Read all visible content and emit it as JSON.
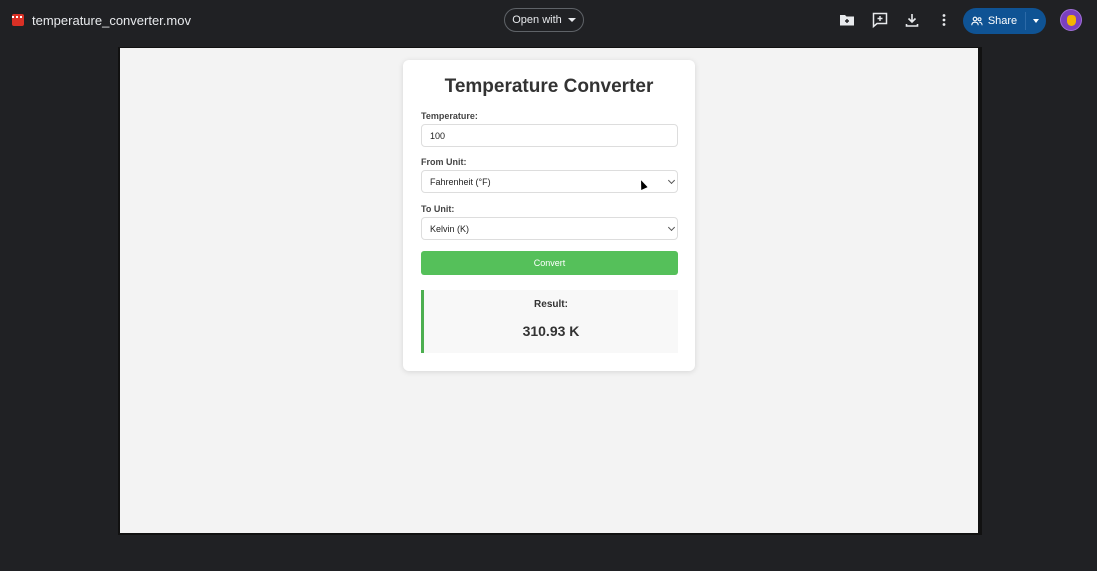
{
  "topbar": {
    "file_icon": "video-file-icon",
    "file_name": "temperature_converter.mov",
    "open_with_label": "Open with",
    "icons": [
      "add-to-drive-icon",
      "add-comment-icon",
      "download-icon",
      "more-vert-icon"
    ],
    "share_label": "Share",
    "accent_color": "#0f5394"
  },
  "converter": {
    "title": "Temperature Converter",
    "temperature_label": "Temperature:",
    "temperature_value": "100",
    "from_label": "From Unit:",
    "from_value": "Fahrenheit (°F)",
    "to_label": "To Unit:",
    "to_value": "Kelvin (K)",
    "convert_label": "Convert",
    "button_color": "#55c05a",
    "result_label": "Result:",
    "result_value": "310.93 K"
  }
}
